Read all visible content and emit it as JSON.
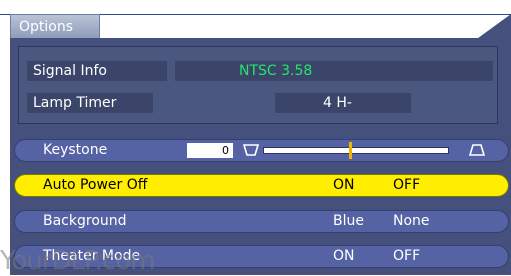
{
  "tab": {
    "label": "Options"
  },
  "info": {
    "signal_label": "Signal Info",
    "signal_value": "NTSC 3.58",
    "lamp_label": "Lamp Timer",
    "lamp_value": "4 H-"
  },
  "menu": {
    "keystone": {
      "label": "Keystone",
      "value": "0",
      "slider_fraction": 0.47
    },
    "auto_power_off": {
      "label": "Auto Power Off",
      "opt1": "ON",
      "opt2": "OFF"
    },
    "background": {
      "label": "Background",
      "opt1": "Blue",
      "opt2": "None"
    },
    "theater_mode": {
      "label": "Theater Mode",
      "opt1": "ON",
      "opt2": "OFF"
    }
  },
  "watermark": "YourDLP.com",
  "colors": {
    "panel": "#45507d",
    "row": "#5563a4",
    "selected": "#ffee00",
    "signal_value": "#27e36a"
  }
}
